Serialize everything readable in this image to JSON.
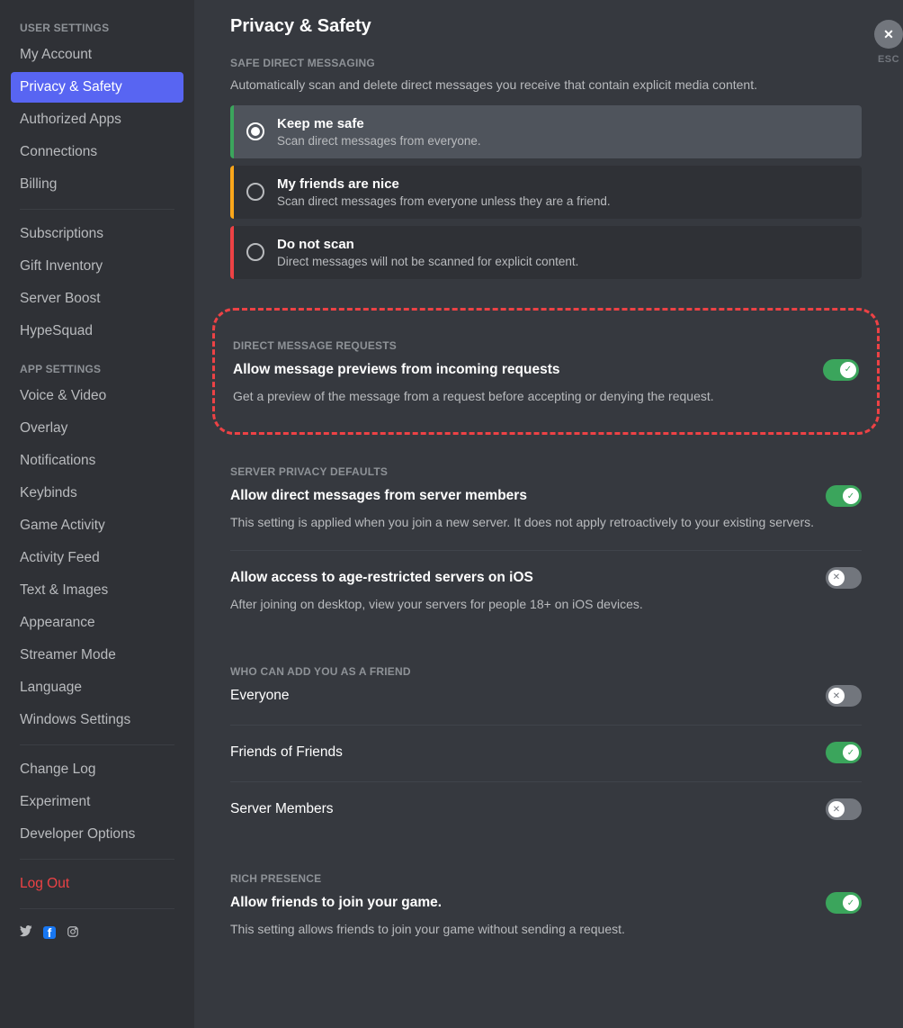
{
  "sidebar": {
    "heading_user": "USER SETTINGS",
    "heading_app": "APP SETTINGS",
    "user_items": [
      "My Account",
      "Privacy & Safety",
      "Authorized Apps",
      "Connections",
      "Billing"
    ],
    "user_items2": [
      "Subscriptions",
      "Gift Inventory",
      "Server Boost",
      "HypeSquad"
    ],
    "app_items": [
      "Voice & Video",
      "Overlay",
      "Notifications",
      "Keybinds",
      "Game Activity",
      "Activity Feed",
      "Text & Images",
      "Appearance",
      "Streamer Mode",
      "Language",
      "Windows Settings"
    ],
    "misc_items": [
      "Change Log",
      "Experiment",
      "Developer Options"
    ],
    "logout": "Log Out"
  },
  "page": {
    "title": "Privacy & Safety",
    "esc": "ESC"
  },
  "safe_dm": {
    "heading": "SAFE DIRECT MESSAGING",
    "desc": "Automatically scan and delete direct messages you receive that contain explicit media content.",
    "opts": [
      {
        "title": "Keep me safe",
        "sub": "Scan direct messages from everyone."
      },
      {
        "title": "My friends are nice",
        "sub": "Scan direct messages from everyone unless they are a friend."
      },
      {
        "title": "Do not scan",
        "sub": "Direct messages will not be scanned for explicit content."
      }
    ]
  },
  "dm_requests": {
    "heading": "DIRECT MESSAGE REQUESTS",
    "title": "Allow message previews from incoming requests",
    "desc": "Get a preview of the message from a request before accepting or denying the request."
  },
  "server_privacy": {
    "heading": "SERVER PRIVACY DEFAULTS",
    "items": [
      {
        "title": "Allow direct messages from server members",
        "desc": "This setting is applied when you join a new server. It does not apply retroactively to your existing servers.",
        "on": true
      },
      {
        "title": "Allow access to age-restricted servers on iOS",
        "desc": "After joining on desktop, view your servers for people 18+ on iOS devices.",
        "on": false
      }
    ]
  },
  "friend": {
    "heading": "WHO CAN ADD YOU AS A FRIEND",
    "items": [
      {
        "title": "Everyone",
        "on": false
      },
      {
        "title": "Friends of Friends",
        "on": true
      },
      {
        "title": "Server Members",
        "on": false
      }
    ]
  },
  "rich": {
    "heading": "RICH PRESENCE",
    "title": "Allow friends to join your game.",
    "desc": "This setting allows friends to join your game without sending a request.",
    "on": true
  }
}
